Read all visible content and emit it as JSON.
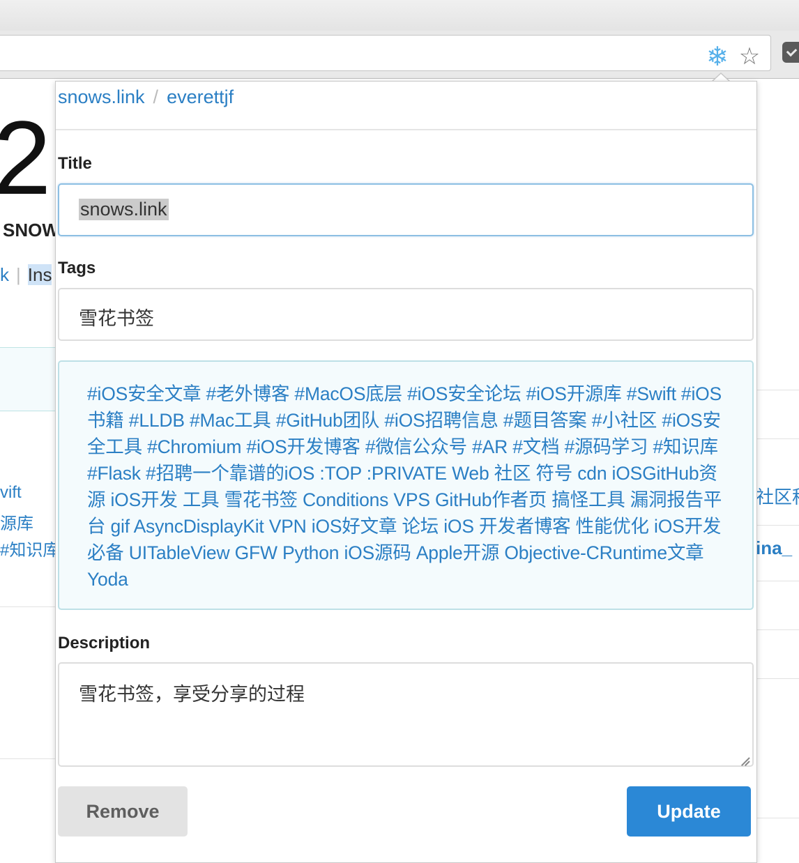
{
  "browser": {
    "extension_icon": "snowflake-icon",
    "bookmark_icon": "star-icon",
    "pocket_icon": "pocket-icon"
  },
  "background_page": {
    "big_number": "2",
    "site_name": "SNOW",
    "links": [
      "k",
      "Ins"
    ],
    "left_snippets": [
      "vift",
      "源库",
      "#知识库"
    ],
    "right_snippets": [
      "社区程",
      "ina_"
    ]
  },
  "popup": {
    "breadcrumb": [
      "snows.link",
      "everettjf"
    ],
    "title_label": "Title",
    "title_value": "snows.link",
    "tags_label": "Tags",
    "tags_value": "雪花书签",
    "tag_suggestions": [
      "#iOS安全文章",
      "#老外博客",
      "#MacOS底层",
      "#iOS安全论坛",
      "#iOS开源库",
      "#Swift",
      "#iOS书籍",
      "#LLDB",
      "#Mac工具",
      "#GitHub团队",
      "#iOS招聘信息",
      "#题目答案",
      "#小社区",
      "#iOS安全工具",
      "#Chromium",
      "#iOS开发博客",
      "#微信公众号",
      "#AR",
      "#文档",
      "#源码学习",
      "#知识库",
      "#Flask",
      "#招聘一个靠谱的iOS",
      ":TOP",
      ":PRIVATE",
      "Web",
      "社区",
      "符号",
      "cdn",
      "iOSGitHub资源",
      "iOS开发",
      "工具",
      "雪花书签",
      "Conditions",
      "VPS",
      "GitHub作者页",
      "搞怪工具",
      "漏洞报告平台",
      "gif",
      "AsyncDisplayKit",
      "VPN",
      "iOS好文章",
      "论坛",
      "iOS",
      "开发者博客",
      "性能优化",
      "iOS开发必备",
      "UITableView",
      "GFW",
      "Python",
      "iOS源码",
      "Apple开源",
      "Objective-CRuntime文章",
      "Yoda"
    ],
    "description_label": "Description",
    "description_value": "雪花书签，享受分享的过程",
    "remove_label": "Remove",
    "update_label": "Update"
  },
  "colors": {
    "link": "#2b7fc4",
    "primary_button": "#2b88d6",
    "secondary_button": "#e3e3e3",
    "tag_box_bg": "#f4fbfd"
  }
}
